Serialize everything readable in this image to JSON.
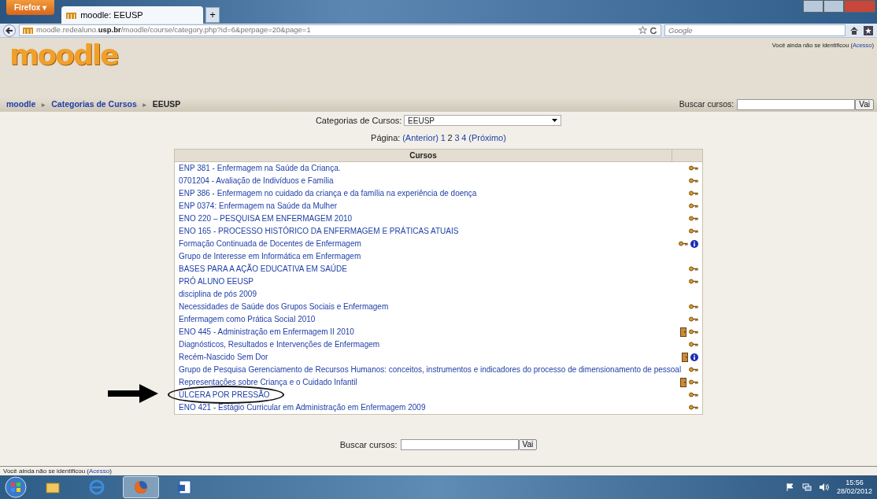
{
  "browser": {
    "menu_button": "Firefox ▾",
    "tabs": [
      {
        "title": "moodle: EEUSP",
        "selected": true
      }
    ],
    "new_tab": "+",
    "address": {
      "host_start": "moodle.redealuno.",
      "host_bold": "usp.br",
      "path": "/moodle/course/category.php?id=6&perpage=20&page=1"
    },
    "search_placeholder": "Google"
  },
  "header": {
    "logo": "moodle",
    "login_text": "Você ainda não se identificou (",
    "login_link": "Acesso",
    "login_end": ")"
  },
  "breadcrumb": [
    {
      "label": "moodle",
      "kind": "link"
    },
    {
      "separator": "►",
      "label": "Categorias de Cursos",
      "kind": "link"
    },
    {
      "separator": "►",
      "label": "EEUSP",
      "kind": "current"
    }
  ],
  "top_search": {
    "label": "Buscar cursos:",
    "button": "Vai"
  },
  "category_select": {
    "label": "Categorias de Cursos:",
    "value": "EEUSP"
  },
  "paging": {
    "label": "Página:",
    "prev": "(Anterior)",
    "pages": [
      {
        "label": "1",
        "selected": false
      },
      {
        "label": "2",
        "selected": true
      },
      {
        "label": "3",
        "selected": false
      },
      {
        "label": "4",
        "selected": false
      }
    ],
    "next": "(Próximo)"
  },
  "table": {
    "columns": [
      "Cursos"
    ],
    "rows": [
      {
        "name": "ENP 381 - Enfermagem na Saúde da Criança.",
        "icons": [
          {
            "kind": "key"
          }
        ]
      },
      {
        "name": "0701204 - Avaliação de Indivíduos e Família",
        "icons": [
          {
            "kind": "key"
          }
        ]
      },
      {
        "name": "ENP 386 - Enfermagem no cuidado da criança e da família na experiência de doença",
        "icons": [
          {
            "kind": "key"
          }
        ]
      },
      {
        "name": "ENP 0374: Enfermagem na Saúde da Mulher",
        "icons": [
          {
            "kind": "key"
          }
        ]
      },
      {
        "name": "ENO 220 – PESQUISA EM ENFERMAGEM 2010",
        "icons": [
          {
            "kind": "key"
          }
        ]
      },
      {
        "name": "ENO 165 - PROCESSO HISTÓRICO DA ENFERMAGEM E PRÁTICAS ATUAIS",
        "icons": [
          {
            "kind": "key"
          }
        ]
      },
      {
        "name": "Formação Continuada de Docentes de Enfermagem",
        "icons": [
          {
            "kind": "key"
          },
          {
            "kind": "info"
          }
        ]
      },
      {
        "name": "Grupo de Interesse em Informática em Enfermagem",
        "icons": []
      },
      {
        "name": "BASES PARA A AÇÃO EDUCATIVA EM SAÚDE",
        "icons": [
          {
            "kind": "key"
          }
        ]
      },
      {
        "name": "PRÓ ALUNO EEUSP",
        "icons": [
          {
            "kind": "key"
          }
        ]
      },
      {
        "name": "disciplina de pós 2009",
        "icons": []
      },
      {
        "name": "Necessidades de Saúde dos Grupos Sociais e Enfermagem",
        "icons": [
          {
            "kind": "key"
          }
        ]
      },
      {
        "name": "Enfermagem como Prática Social 2010",
        "icons": [
          {
            "kind": "key"
          }
        ]
      },
      {
        "name": "ENO 445 - Administração em Enfermagem II 2010",
        "icons": [
          {
            "kind": "door"
          },
          {
            "kind": "key"
          }
        ]
      },
      {
        "name": "Diagnósticos, Resultados e Intervenções de Enfermagem",
        "icons": [
          {
            "kind": "key"
          }
        ]
      },
      {
        "name": "Recém-Nascido Sem Dor",
        "icons": [
          {
            "kind": "door"
          },
          {
            "kind": "info"
          }
        ]
      },
      {
        "name": "Grupo de Pesquisa Gerenciamento de Recursos Humanos: conceitos, instrumentos e indicadores do processo de dimensionamento de pessoal",
        "icons": [
          {
            "kind": "key"
          }
        ]
      },
      {
        "name": "Representações sobre Criança e o Cuidado Infantil",
        "icons": [
          {
            "kind": "door"
          },
          {
            "kind": "key"
          }
        ]
      },
      {
        "name": "ÚLCERA POR PRESSÃO",
        "icons": [
          {
            "kind": "key"
          }
        ],
        "highlighted": true
      },
      {
        "name": "ENO 421 - Estágio Curricular em Administração em Enfermagem 2009",
        "icons": [
          {
            "kind": "key"
          }
        ]
      }
    ]
  },
  "bottom_search": {
    "label": "Buscar cursos:",
    "button": "Vai"
  },
  "footer": {
    "login_text": "Você ainda não se identificou (",
    "login_link": "Acesso",
    "login_end": ")"
  },
  "taskbar": {
    "apps": [
      {
        "kind": "folder",
        "active": false
      },
      {
        "kind": "ie",
        "active": false
      },
      {
        "kind": "firefox",
        "active": true
      },
      {
        "kind": "word",
        "active": false
      }
    ],
    "time": "15:56",
    "date": "28/02/2012"
  }
}
